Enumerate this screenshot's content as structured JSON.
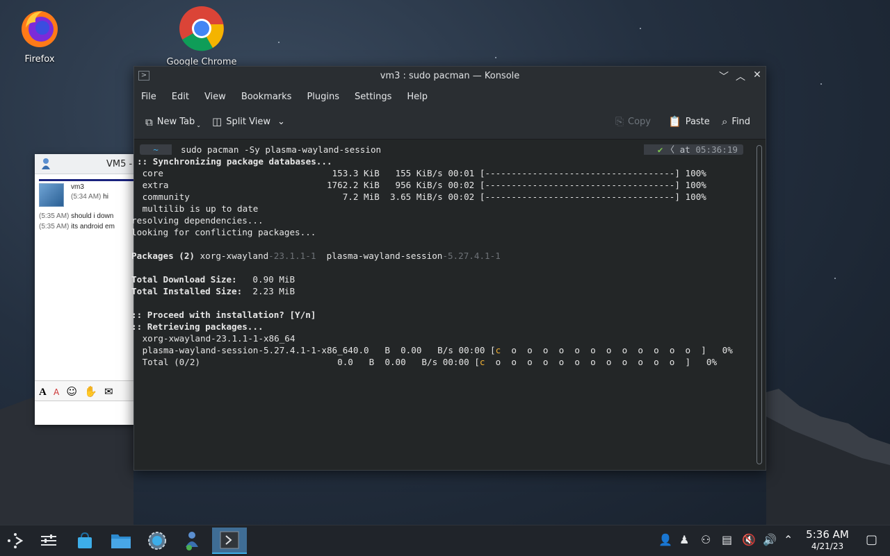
{
  "desktop": {
    "icons": [
      {
        "label": "Firefox"
      },
      {
        "label": "Google Chrome"
      }
    ]
  },
  "chat": {
    "title": "VM5 -",
    "contact": "vm3",
    "first_time": "(5:34 AM)",
    "first_text": "hi",
    "messages": [
      {
        "time": "(5:35 AM)",
        "text": "should i down"
      },
      {
        "time": "(5:35 AM)",
        "text": "its android em"
      }
    ]
  },
  "konsole": {
    "title": "vm3 : sudo pacman — Konsole",
    "menu": [
      "File",
      "Edit",
      "View",
      "Bookmarks",
      "Plugins",
      "Settings",
      "Help"
    ],
    "toolbar": {
      "new_tab": "New Tab",
      "split_view": "Split View",
      "copy": "Copy",
      "paste": "Paste",
      "find": "Find"
    },
    "prompt": {
      "dir": "~",
      "command": "sudo pacman -Sy plasma-wayland-session",
      "at": "at",
      "time": "05:36:19"
    },
    "lines": {
      "sync": ":: Synchronizing package databases...",
      "core": " core                                153.3 KiB   155 KiB/s 00:01 [------------------------------------] 100%",
      "extra": " extra                              1762.2 KiB   956 KiB/s 00:02 [------------------------------------] 100%",
      "community": " community                             7.2 MiB  3.65 MiB/s 00:02 [------------------------------------] 100%",
      "multilib": " multilib is up to date",
      "resolving": "resolving dependencies...",
      "conflicting": "looking for conflicting packages...",
      "packages_label": "Packages (2)",
      "pkg1_name": " xorg-xwayland",
      "pkg1_ver": "-23.1.1-1",
      "pkg2_name": "  plasma-wayland-session",
      "pkg2_ver": "-5.27.4.1-1",
      "download_label": "Total Download Size:",
      "download_value": "   0.90 MiB",
      "installed_label": "Total Installed Size:",
      "installed_value": "  2.23 MiB",
      "proceed": ":: Proceed with installation? [Y/n]",
      "retrieving": ":: Retrieving packages...",
      "xorg_dl": " xorg-xwayland-23.1.1-1-x86_64",
      "plasma_dl_a": " plasma-wayland-session-5.27.4.1-1-x86_640.0   B  0.00   B/s 00:00 [",
      "plasma_dl_c": "c",
      "plasma_dl_b": "  o  o  o  o  o  o  o  o  o  o  o  o  ]   0%",
      "total_a": " Total (0/2)                          0.0   B  0.00   B/s 00:00 [",
      "total_c": "c",
      "total_b": "  o  o  o  o  o  o  o  o  o  o  o  o  ]   0%"
    }
  },
  "taskbar": {
    "clock_time": "5:36 AM",
    "clock_date": "4/21/23"
  }
}
